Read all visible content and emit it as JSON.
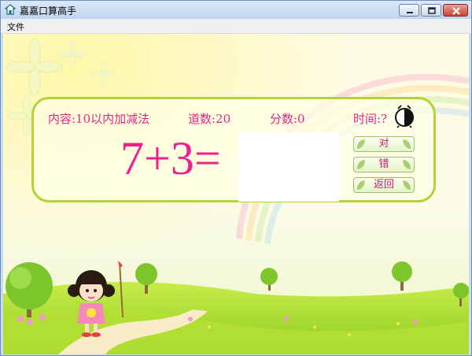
{
  "window": {
    "title": "嘉嘉口算高手"
  },
  "menu": {
    "items": [
      {
        "label": "文件"
      }
    ]
  },
  "status": {
    "content": "内容:10以内加减法",
    "count": "道数:20",
    "score": "分数:0",
    "time": "时间:?"
  },
  "problem": {
    "text": "7+3="
  },
  "buttons": {
    "correct": "对",
    "wrong": "错",
    "back": "返回"
  },
  "colors": {
    "accent": "#e0288a",
    "problem": "#ee1f8e",
    "panel_border": "#b3d334"
  },
  "icons": [
    "app-icon",
    "minimize-icon",
    "maximize-icon",
    "close-icon",
    "clock-icon",
    "leaf-icon"
  ]
}
